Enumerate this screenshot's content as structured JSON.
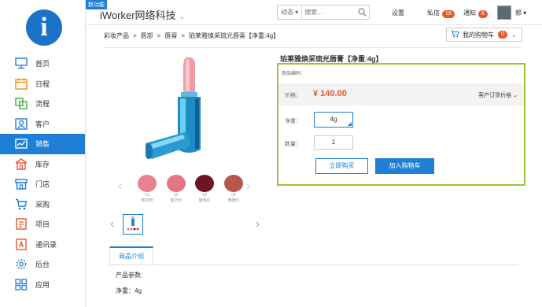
{
  "logo": {
    "letter": "i"
  },
  "sidebar": {
    "items": [
      {
        "label": "首页",
        "icon": "monitor-icon"
      },
      {
        "label": "日程",
        "icon": "calendar-icon"
      },
      {
        "label": "流程",
        "icon": "flow-icon"
      },
      {
        "label": "客户",
        "icon": "customer-icon"
      },
      {
        "label": "销售",
        "icon": "sales-icon",
        "active": true
      },
      {
        "label": "库存",
        "icon": "warehouse-icon"
      },
      {
        "label": "门店",
        "icon": "store-icon"
      },
      {
        "label": "采购",
        "icon": "cart-icon"
      },
      {
        "label": "项目",
        "icon": "project-icon"
      },
      {
        "label": "通讯录",
        "icon": "contacts-icon"
      },
      {
        "label": "后台",
        "icon": "gear-icon"
      },
      {
        "label": "应用",
        "icon": "apps-icon"
      }
    ]
  },
  "topbar": {
    "new_badge": "新功能",
    "brand": "iWorker网络科技",
    "search_scope": "动态",
    "search_placeholder": "搜索...",
    "settings": "设置",
    "messages": "私信",
    "messages_count": "18",
    "notices": "通知",
    "notices_count": "8",
    "user": "郭"
  },
  "breadcrumb": {
    "items": [
      "彩妆产品",
      "唇部",
      "唇膏",
      "珀莱雅焕采琉光唇膏【净重:4g】"
    ],
    "sep": ">"
  },
  "cart": {
    "label": "我的购物车",
    "count": "0"
  },
  "product": {
    "title": "珀莱雅焕采琉光唇膏【净重:4g】",
    "code_label": "商品编码：",
    "price_label": "价格：",
    "price": "¥ 140.00",
    "order_price": "客户订货价格",
    "net_label": "净重：",
    "net_value": "4g",
    "qty_label": "数量：",
    "qty_value": "1",
    "buy_now": "立即购买",
    "add_cart": "加入购物车"
  },
  "swatches": [
    {
      "code": "01",
      "name": "樱花粉",
      "color": "#e9818e"
    },
    {
      "code": "02",
      "name": "蜜恋粉",
      "color": "#e57585"
    },
    {
      "code": "03",
      "name": "魅惑红",
      "color": "#6e1422"
    },
    {
      "code": "04",
      "name": "微醺红",
      "color": "#b5574d"
    }
  ],
  "tabs": {
    "intro": "商品介绍"
  },
  "params": {
    "title": "产品参数:",
    "net": "净重：4g"
  },
  "colors": {
    "accent": "#1f7fd6",
    "price": "#e8542f",
    "panel_border": "#9ac43a"
  }
}
